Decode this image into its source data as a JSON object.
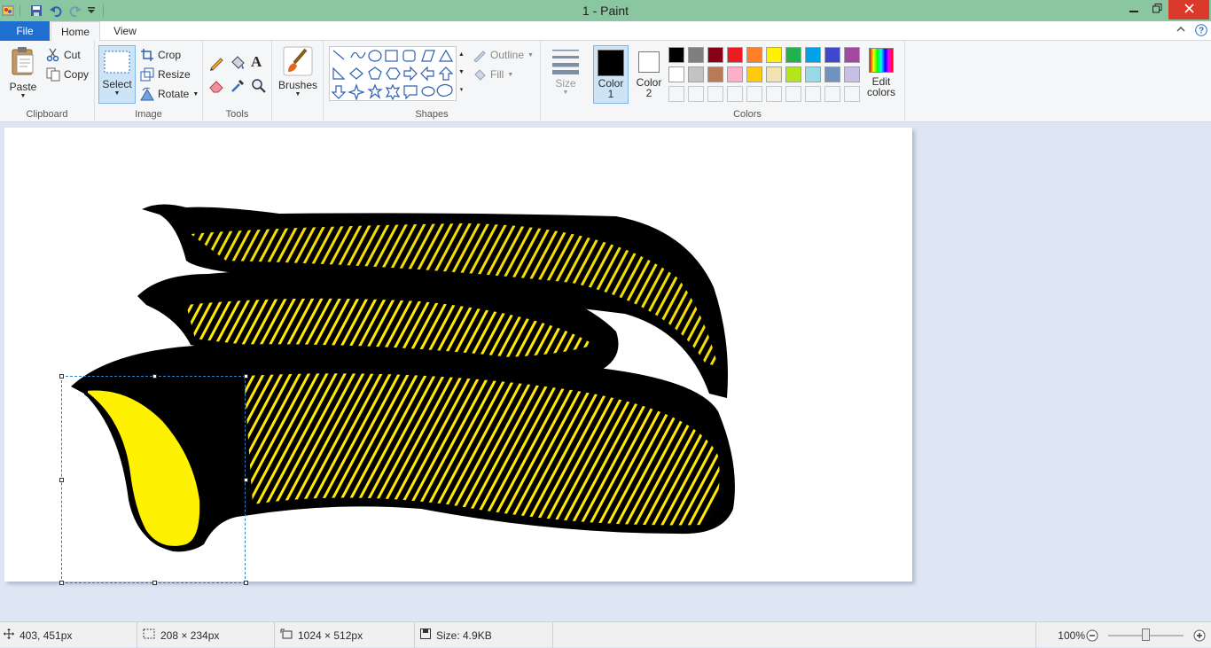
{
  "window": {
    "title": "1 - Paint"
  },
  "tabs": {
    "file": "File",
    "home": "Home",
    "view": "View"
  },
  "clipboard": {
    "paste": "Paste",
    "cut": "Cut",
    "copy": "Copy",
    "group_label": "Clipboard"
  },
  "image": {
    "select": "Select",
    "crop": "Crop",
    "resize": "Resize",
    "rotate": "Rotate",
    "group_label": "Image"
  },
  "tools": {
    "group_label": "Tools"
  },
  "brushes": {
    "label": "Brushes"
  },
  "shapes": {
    "outline": "Outline",
    "fill": "Fill",
    "group_label": "Shapes"
  },
  "size": {
    "label": "Size"
  },
  "colors": {
    "color1_label_a": "Color",
    "color1_label_b": "1",
    "color2_label_a": "Color",
    "color2_label_b": "2",
    "edit_a": "Edit",
    "edit_b": "colors",
    "group_label": "Colors",
    "color1": "#000000",
    "color2": "#ffffff",
    "palette_row1": [
      "#000000",
      "#7f7f7f",
      "#880015",
      "#ed1c24",
      "#ff7f27",
      "#fff200",
      "#22b14c",
      "#00a2e8",
      "#3f48cc",
      "#a349a4"
    ],
    "palette_row2": [
      "#ffffff",
      "#c3c3c3",
      "#b97a57",
      "#ffaec9",
      "#ffc90e",
      "#efe4b0",
      "#b5e61d",
      "#99d9ea",
      "#7092be",
      "#c8bfe7"
    ]
  },
  "status": {
    "cursor_pos": "403, 451px",
    "selection_size": "208 × 234px",
    "image_size": "1024 × 512px",
    "file_size": "Size: 4.9KB",
    "zoom": "100%",
    "zoom_level": 0.5
  }
}
